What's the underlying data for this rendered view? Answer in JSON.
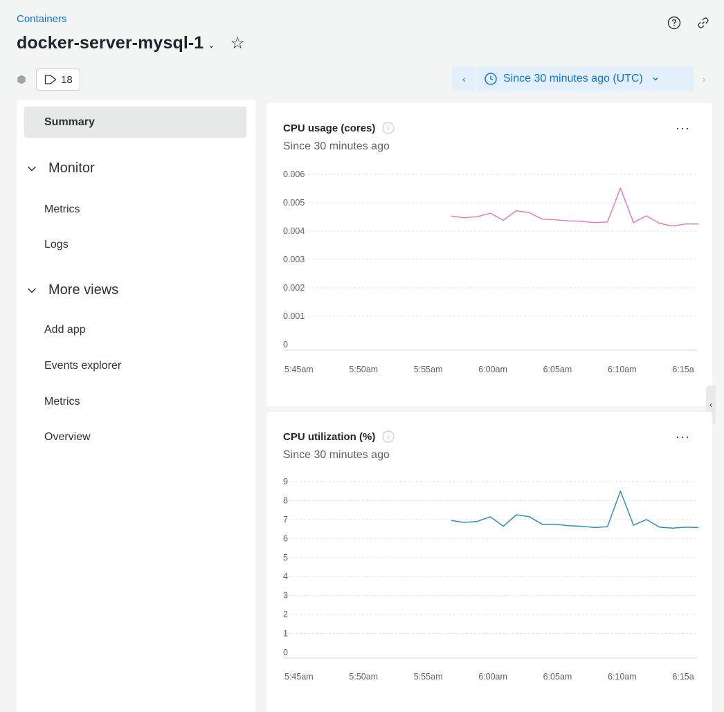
{
  "header": {
    "breadcrumb": "Containers",
    "title": "docker-server-mysql-1",
    "tag_count": "18",
    "time_picker_label": "Since 30 minutes ago (UTC)"
  },
  "sidebar": {
    "summary": "Summary",
    "monitor_group": "Monitor",
    "monitor_items": [
      "Metrics",
      "Logs"
    ],
    "more_group": "More views",
    "more_items": [
      "Add app",
      "Events explorer",
      "Metrics",
      "Overview"
    ]
  },
  "cards": [
    {
      "title": "CPU usage (cores)",
      "subtitle": "Since 30 minutes ago"
    },
    {
      "title": "CPU utilization (%)",
      "subtitle": "Since 30 minutes ago"
    }
  ],
  "colors": {
    "accent": "#0c74df",
    "cpu_usage_line": "#e37cc4",
    "cpu_util_line": "#2f90b5"
  },
  "chart_data": [
    {
      "type": "line",
      "title": "CPU usage (cores)",
      "subtitle": "Since 30 minutes ago",
      "x_ticks": [
        "5:45am",
        "5:50am",
        "5:55am",
        "6:00am",
        "6:05am",
        "6:10am",
        "6:15a"
      ],
      "y_ticks": [
        "0",
        "0.001",
        "0.002",
        "0.003",
        "0.004",
        "0.005",
        "0.006"
      ],
      "ylim": [
        0,
        0.006
      ],
      "x": [
        "5:56:45am",
        "5:57:45am",
        "5:58:45am",
        "5:59:45am",
        "6:00:45am",
        "6:01:45am",
        "6:02:45am",
        "6:03:45am",
        "6:04:45am",
        "6:05:45am",
        "6:06:45am",
        "6:07:45am",
        "6:08:45am",
        "6:09:45am",
        "6:10:45am",
        "6:11:45am",
        "6:12:45am",
        "6:13:45am",
        "6:14:45am",
        "6:15:45am"
      ],
      "values": [
        0.00453,
        0.00447,
        0.00451,
        0.00463,
        0.00438,
        0.00472,
        0.00465,
        0.00442,
        0.0044,
        0.00436,
        0.00435,
        0.0043,
        0.00432,
        0.00552,
        0.0043,
        0.00454,
        0.00427,
        0.00418,
        0.00425,
        0.00425
      ],
      "x_index": [
        0,
        1,
        2,
        3,
        4,
        5,
        6,
        7,
        8,
        9,
        10,
        11,
        12,
        13,
        14,
        15,
        16,
        17,
        18,
        19
      ],
      "grid": true,
      "legend": "none"
    },
    {
      "type": "line",
      "title": "CPU utilization (%)",
      "subtitle": "Since 30 minutes ago",
      "x_ticks": [
        "5:45am",
        "5:50am",
        "5:55am",
        "6:00am",
        "6:05am",
        "6:10am",
        "6:15a"
      ],
      "y_ticks": [
        "0",
        "1",
        "2",
        "3",
        "4",
        "5",
        "6",
        "7",
        "8",
        "9"
      ],
      "ylim": [
        0,
        9
      ],
      "x": [
        "5:56:45am",
        "5:57:45am",
        "5:58:45am",
        "5:59:45am",
        "6:00:45am",
        "6:01:45am",
        "6:02:45am",
        "6:03:45am",
        "6:04:45am",
        "6:05:45am",
        "6:06:45am",
        "6:07:45am",
        "6:08:45am",
        "6:09:45am",
        "6:10:45am",
        "6:11:45am",
        "6:12:45am",
        "6:13:45am",
        "6:14:45am",
        "6:15:45am"
      ],
      "values": [
        6.95,
        6.85,
        6.9,
        7.15,
        6.65,
        7.25,
        7.15,
        6.75,
        6.75,
        6.68,
        6.65,
        6.58,
        6.62,
        8.5,
        6.7,
        7.0,
        6.6,
        6.55,
        6.6,
        6.58
      ],
      "grid": true,
      "legend": "none"
    }
  ]
}
